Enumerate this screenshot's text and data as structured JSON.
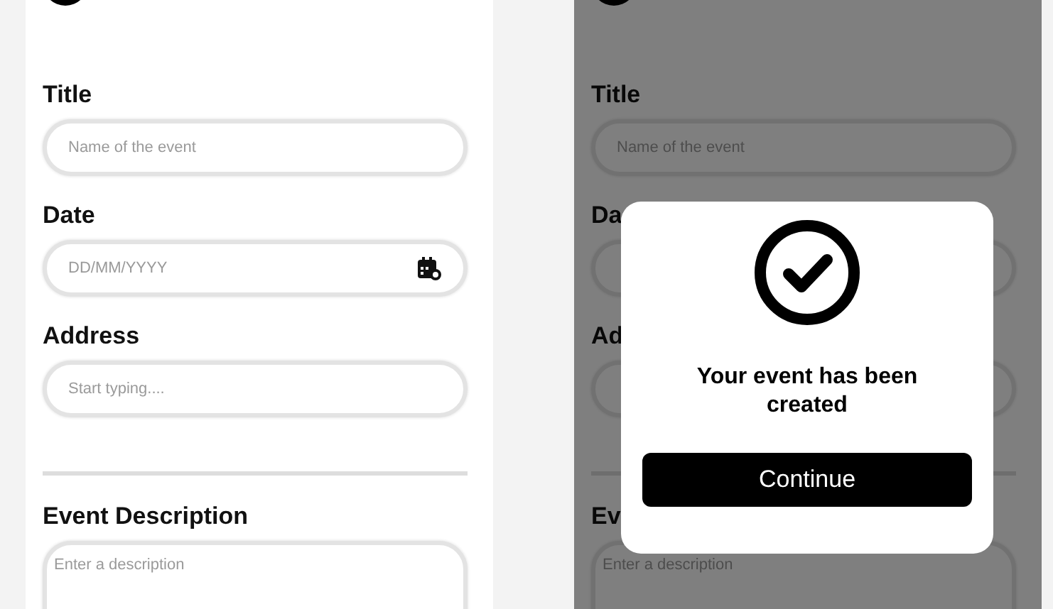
{
  "screens": [
    {
      "dimmed": false,
      "items": [
        {
          "kind": "field",
          "label": "Title",
          "placeholder": "Name of the event"
        },
        {
          "kind": "date",
          "label": "Date",
          "placeholder": "DD/MM/YYYY"
        },
        {
          "kind": "field",
          "label": "Address",
          "placeholder": "Start typing...."
        },
        {
          "kind": "divider"
        },
        {
          "kind": "textarea",
          "label": "Event Description",
          "placeholder": "Enter a description"
        }
      ]
    },
    {
      "dimmed": true,
      "items": [
        {
          "kind": "field",
          "label": "Title",
          "placeholder": "Name of the event"
        },
        {
          "kind": "date",
          "label": "Da"
        },
        {
          "kind": "field",
          "label": "Ad"
        },
        {
          "kind": "divider"
        },
        {
          "kind": "textarea",
          "label": "Ev",
          "placeholder": "Enter a description"
        }
      ],
      "modal": {
        "message": "Your event has been created",
        "button": "Continue"
      }
    }
  ]
}
